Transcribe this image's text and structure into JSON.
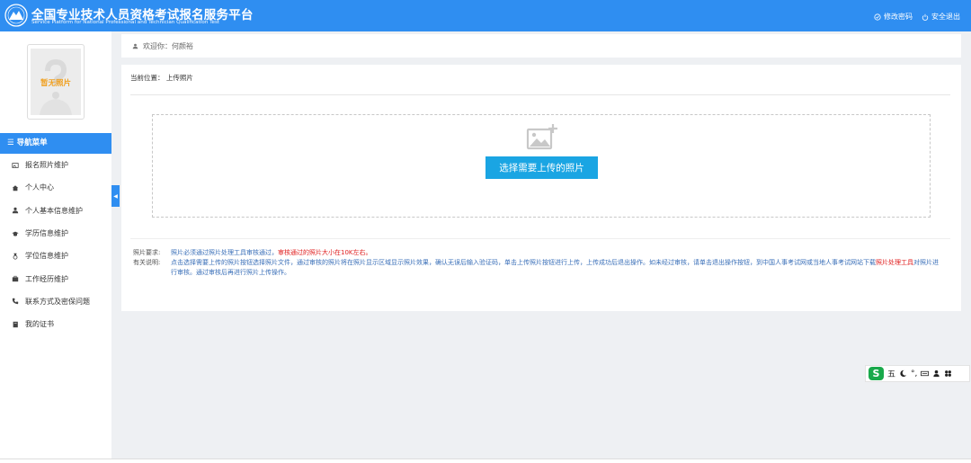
{
  "header": {
    "title_cn": "全国专业技术人员资格考试报名服务平台",
    "title_en": "Service Platform for National Professional and Technician Qualification Test",
    "change_password": "修改密码",
    "logout": "安全退出"
  },
  "sidebar": {
    "photo_placeholder": "暂无照片",
    "nav_title": "导航菜单",
    "items": [
      {
        "label": "报名照片维护",
        "icon": "image-icon"
      },
      {
        "label": "个人中心",
        "icon": "home-icon"
      },
      {
        "label": "个人基本信息维护",
        "icon": "user-icon"
      },
      {
        "label": "学历信息维护",
        "icon": "graduation-cap-icon"
      },
      {
        "label": "学位信息维护",
        "icon": "medal-icon"
      },
      {
        "label": "工作经历维护",
        "icon": "briefcase-icon"
      },
      {
        "label": "联系方式及密保问题",
        "icon": "phone-icon"
      },
      {
        "label": "我的证书",
        "icon": "book-icon"
      }
    ],
    "collapse_glyph": "◀"
  },
  "welcome": {
    "text": "欢迎你：何颜裕"
  },
  "main": {
    "breadcrumb": "当前位置： 上传照片",
    "upload_button": "选择需要上传的照片",
    "notes": {
      "requirement_label": "照片要求:",
      "requirement_text": "照片必须通过照片处理工具审核通过，",
      "requirement_red": "审核通过的照片大小在10K左右。",
      "instructions_label": "有关说明:",
      "instructions_text_1": "点击选择需要上传的照片按钮选择照片文件，通过审核的照片将在照片显示区域显示照片效果，确认无误后输入验证码，单击上传照片按钮进行上传，上传成功后退出操作。如未经过审核，请单击退出操作按钮，到中国人事考试网或当",
      "instructions_text_2": "地人事考试网站下载",
      "instructions_red": "照片处理工具",
      "instructions_text_3": "对照片进行审核。通过审核后再进行照片上传操作。"
    }
  },
  "ime": {
    "logo": "S",
    "mode": "五",
    "punct": "°,"
  },
  "colors": {
    "primary": "#2f8ef1",
    "button": "#1aa5e3",
    "warning": "#e02020",
    "link_text": "#3a6fb8"
  }
}
